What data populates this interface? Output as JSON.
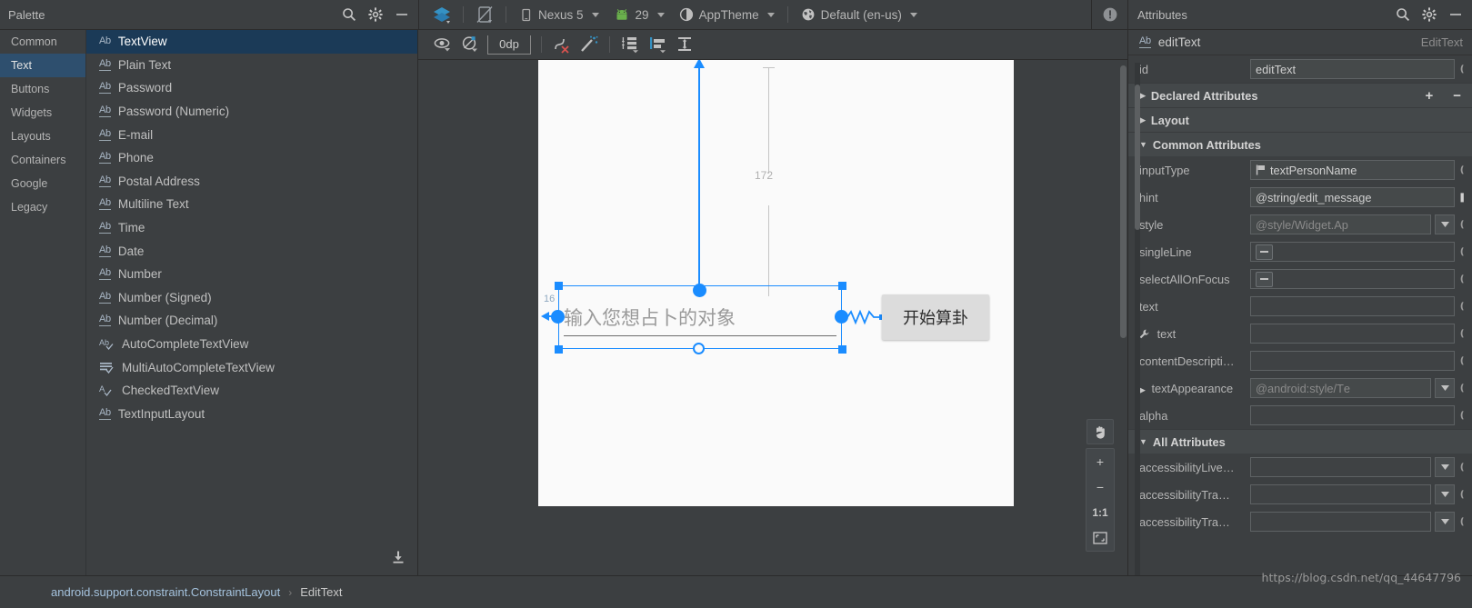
{
  "palette": {
    "title": "Palette",
    "icons": [
      "search-icon",
      "gear-icon",
      "minimize-icon"
    ],
    "categories": [
      {
        "label": "Common",
        "active": false
      },
      {
        "label": "Text",
        "active": true
      },
      {
        "label": "Buttons",
        "active": false
      },
      {
        "label": "Widgets",
        "active": false
      },
      {
        "label": "Layouts",
        "active": false
      },
      {
        "label": "Containers",
        "active": false
      },
      {
        "label": "Google",
        "active": false
      },
      {
        "label": "Legacy",
        "active": false
      }
    ],
    "items": [
      {
        "label": "TextView",
        "icon": "ab-plain-icon",
        "selected": true
      },
      {
        "label": "Plain Text",
        "icon": "ab-underline-icon",
        "selected": false
      },
      {
        "label": "Password",
        "icon": "ab-underline-icon",
        "selected": false
      },
      {
        "label": "Password (Numeric)",
        "icon": "ab-underline-icon",
        "selected": false
      },
      {
        "label": "E-mail",
        "icon": "ab-underline-icon",
        "selected": false
      },
      {
        "label": "Phone",
        "icon": "ab-underline-icon",
        "selected": false
      },
      {
        "label": "Postal Address",
        "icon": "ab-underline-icon",
        "selected": false
      },
      {
        "label": "Multiline Text",
        "icon": "ab-underline-icon",
        "selected": false
      },
      {
        "label": "Time",
        "icon": "ab-underline-icon",
        "selected": false
      },
      {
        "label": "Date",
        "icon": "ab-underline-icon",
        "selected": false
      },
      {
        "label": "Number",
        "icon": "ab-underline-icon",
        "selected": false
      },
      {
        "label": "Number (Signed)",
        "icon": "ab-underline-icon",
        "selected": false
      },
      {
        "label": "Number (Decimal)",
        "icon": "ab-underline-icon",
        "selected": false
      },
      {
        "label": "AutoCompleteTextView",
        "icon": "ab-check-icon",
        "selected": false
      },
      {
        "label": "MultiAutoCompleteTextView",
        "icon": "lines-check-icon",
        "selected": false
      },
      {
        "label": "CheckedTextView",
        "icon": "a-check-icon",
        "selected": false
      },
      {
        "label": "TextInputLayout",
        "icon": "ab-underline-icon",
        "selected": false
      }
    ],
    "download_icon": "download-icon"
  },
  "toolbar": {
    "design_mode_icon": "layers-icon",
    "orientation_icon": "rotate-device-icon",
    "device": "Nexus 5",
    "api_level": "29",
    "theme": "AppTheme",
    "locale": "Default (en-us)",
    "device_icon": "phone-icon",
    "api_icon": "android-icon",
    "theme_icon": "theme-contrast-icon",
    "locale_icon": "globe-icon",
    "warning_icon": "warning-badge-icon"
  },
  "constraint_toolbar": {
    "view_options_icon": "eye-icon",
    "show_constraints_icon": "constraints-off-icon",
    "default_margin": "0dp",
    "clear_constraints_icon": "clear-constraints-icon",
    "infer_constraints_icon": "magic-wand-icon",
    "pack_icon": "pack-vertical-icon",
    "align_icon": "align-left-icon",
    "guidelines_icon": "guidelines-icon"
  },
  "canvas": {
    "editText": {
      "hint": "输入您想占卜的对象",
      "margin_top": "172",
      "margin_left": "16"
    },
    "button": {
      "label": "开始算卦"
    },
    "zoom_controls": {
      "pan_icon": "pan-hand-icon",
      "zoom_in": "+",
      "zoom_out": "−",
      "zoom_actual": "1:1",
      "zoom_fit_icon": "zoom-fit-icon"
    },
    "accent_color": "#1a8cff"
  },
  "attributes": {
    "title": "Attributes",
    "icons": [
      "search-icon",
      "gear-icon",
      "minimize-icon"
    ],
    "component_name": "editText",
    "component_type": "EditText",
    "component_icon": "ab-underline-icon",
    "sections": [
      {
        "label": "Declared Attributes",
        "expanded": false,
        "has_add_remove": true,
        "add_label": "+",
        "remove_label": "−"
      },
      {
        "label": "Layout",
        "expanded": false,
        "has_add_remove": false
      },
      {
        "label": "Common Attributes",
        "expanded": true,
        "has_add_remove": false
      }
    ],
    "id_row": {
      "label": "id",
      "value": "editText"
    },
    "common_rows": [
      {
        "label": "inputType",
        "value": "textPersonName",
        "kind": "flag",
        "icon": "flag-icon"
      },
      {
        "label": "hint",
        "value": "@string/edit_message",
        "kind": "text"
      },
      {
        "label": "style",
        "value": "@style/Widget.Ap",
        "kind": "dropdown",
        "muted": true
      },
      {
        "label": "singleLine",
        "value": "",
        "kind": "tristate"
      },
      {
        "label": "selectAllOnFocus",
        "value": "",
        "kind": "tristate"
      },
      {
        "label": "text",
        "value": "",
        "kind": "text"
      },
      {
        "label": "text",
        "value": "",
        "kind": "text",
        "icon": "wrench-icon"
      },
      {
        "label": "contentDescripti…",
        "value": "",
        "kind": "text"
      },
      {
        "label": "textAppearance",
        "value": "@android:style/Tе",
        "kind": "dropdown",
        "muted": true,
        "expandable": true
      },
      {
        "label": "alpha",
        "value": "",
        "kind": "text"
      }
    ],
    "all_attributes_section": {
      "label": "All Attributes",
      "expanded": true
    },
    "all_rows": [
      {
        "label": "accessibilityLive…",
        "value": "",
        "kind": "dropdown"
      },
      {
        "label": "accessibilityTra…",
        "value": "",
        "kind": "dropdown"
      },
      {
        "label": "accessibilityTra…",
        "value": "",
        "kind": "dropdown"
      }
    ]
  },
  "statusbar": {
    "breadcrumb": [
      "android.support.constraint.ConstraintLayout",
      "EditText"
    ],
    "separator": "›",
    "watermark": "https://blog.csdn.net/qq_44647796"
  }
}
